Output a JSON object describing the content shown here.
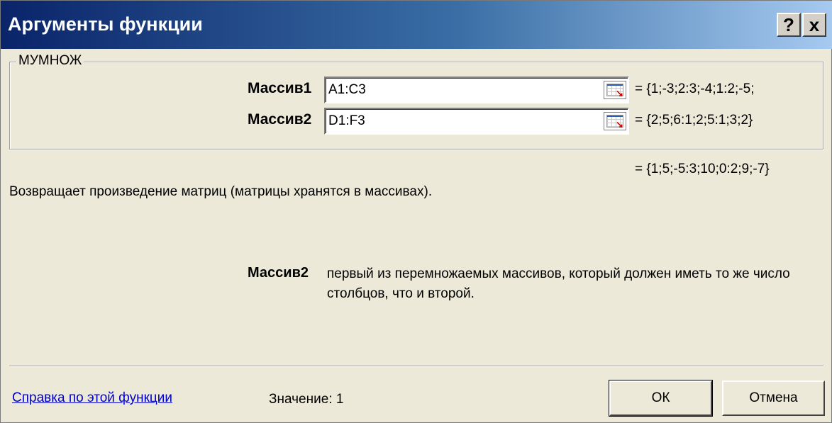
{
  "window": {
    "title": "Аргументы функции",
    "help_button": "?",
    "close_button": "x"
  },
  "function_group": {
    "name": "МУМНОЖ",
    "arguments": [
      {
        "label": "Массив1",
        "value": "A1:C3",
        "evaluated": "= {1;-3;2:3;-4;1:2;-5;"
      },
      {
        "label": "Массив2",
        "value": "D1:F3",
        "evaluated": "= {2;5;6:1;2;5:1;3;2}"
      }
    ]
  },
  "result": "= {1;5;-5:3;10;0:2;9;-7}",
  "description": "Возвращает произведение матриц (матрицы хранятся в массивах).",
  "argument_help": {
    "name": "Массив2",
    "text": "первый из перемножаемых массивов, который должен иметь то же число столбцов, что и второй."
  },
  "footer": {
    "help_link": "Справка по этой функции",
    "value_label": "Значение:",
    "value": "1",
    "ok_label": "ОК",
    "cancel_label": "Отмена"
  },
  "icons": {
    "help": "question-mark-icon",
    "close": "close-icon",
    "range_picker": "range-picker-icon"
  },
  "colors": {
    "titlebar_start": "#0a246a",
    "titlebar_end": "#a6caf0",
    "dialog_background": "#ece9d8",
    "link": "#0000cc"
  }
}
